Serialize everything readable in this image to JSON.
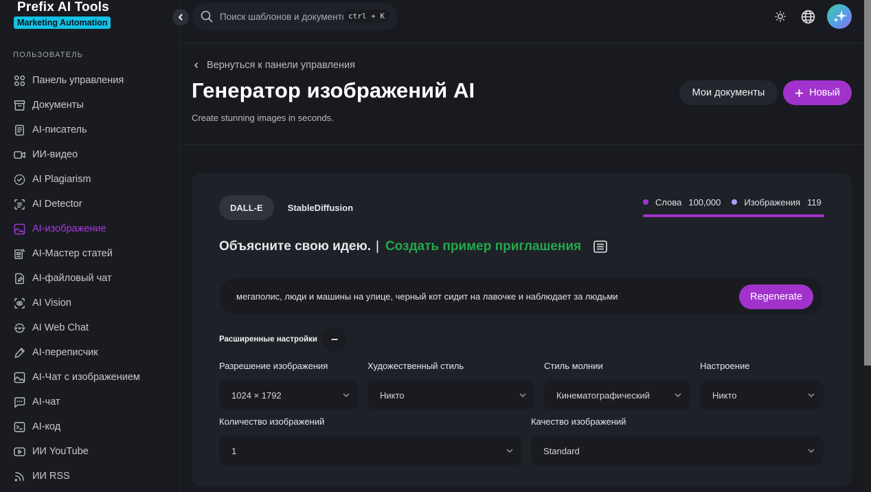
{
  "brand": {
    "title": "Prefix AI Tools",
    "subtitle": "Marketing Automation"
  },
  "sidebar": {
    "section_label": "ПОЛЬЗОВАТЕЛЬ",
    "items": [
      {
        "label": "Панель управления",
        "icon": "dashboard-icon",
        "active": false
      },
      {
        "label": "Документы",
        "icon": "archive-icon",
        "active": false
      },
      {
        "label": "AI-писатель",
        "icon": "document-icon",
        "active": false
      },
      {
        "label": "ИИ-видео",
        "icon": "video-icon",
        "active": false
      },
      {
        "label": "AI Plagiarism",
        "icon": "circle-check-icon",
        "active": false
      },
      {
        "label": "AI Detector",
        "icon": "scan-text-icon",
        "active": false
      },
      {
        "label": "AI-изображение",
        "icon": "image-icon",
        "active": true
      },
      {
        "label": "AI-Мастер статей",
        "icon": "article-wizard-icon",
        "active": false
      },
      {
        "label": "AI-файловый чат",
        "icon": "file-edit-icon",
        "active": false
      },
      {
        "label": "AI Vision",
        "icon": "scan-eye-icon",
        "active": false
      },
      {
        "label": "AI Web Chat",
        "icon": "www-globe-icon",
        "active": false
      },
      {
        "label": "AI-переписчик",
        "icon": "pencil-icon",
        "active": false
      },
      {
        "label": "AI-Чат с изображением",
        "icon": "image-icon",
        "active": false
      },
      {
        "label": "AI-чат",
        "icon": "message-icon",
        "active": false
      },
      {
        "label": "AI-код",
        "icon": "terminal-icon",
        "active": false
      },
      {
        "label": "ИИ YouTube",
        "icon": "youtube-icon",
        "active": false
      },
      {
        "label": "ИИ RSS",
        "icon": "rss-icon",
        "active": false
      }
    ]
  },
  "topbar": {
    "search_placeholder": "Поиск шаблонов и документов...",
    "shortcut": "ctrl + K"
  },
  "header": {
    "back_label": "Вернуться к панели управления",
    "title": "Генератор изображений AI",
    "subtitle": "Create stunning images in seconds.",
    "my_docs_label": "Мои документы",
    "new_label": "Новый"
  },
  "generator": {
    "tabs": [
      {
        "label": "DALL-E",
        "active": true
      },
      {
        "label": "StableDiffusion",
        "active": false
      }
    ],
    "stats": {
      "words_label": "Слова",
      "words_value": "100,000",
      "words_color": "#a133cc",
      "images_label": "Изображения",
      "images_value": "119",
      "images_color": "#a5a3f5",
      "usage_percent": 100
    },
    "idea_label": "Объясните свою идею.",
    "separator": "|",
    "sample_prompt_label": "Создать пример приглашения",
    "prompt_value": "мегаполис, люди и машины на улице, черный кот сидит на лавочке и наблюдает за людьми",
    "regenerate_label": "Regenerate",
    "advanced_label": "Расширенные настройки",
    "fields": {
      "resolution": {
        "label": "Разрешение изображения",
        "value": "1024 × 1792"
      },
      "art_style": {
        "label": "Художественный стиль",
        "value": "Никто"
      },
      "lighting_style": {
        "label": "Стиль молнии",
        "value": "Кинематографический"
      },
      "mood": {
        "label": "Настроение",
        "value": "Никто"
      },
      "count": {
        "label": "Количество изображений",
        "value": "1"
      },
      "quality": {
        "label": "Качество изображений",
        "value": "Standard"
      }
    }
  },
  "colors": {
    "accent": "#a133cc",
    "sample_link": "#23a84d",
    "brand_badge": "#14c1e4"
  }
}
